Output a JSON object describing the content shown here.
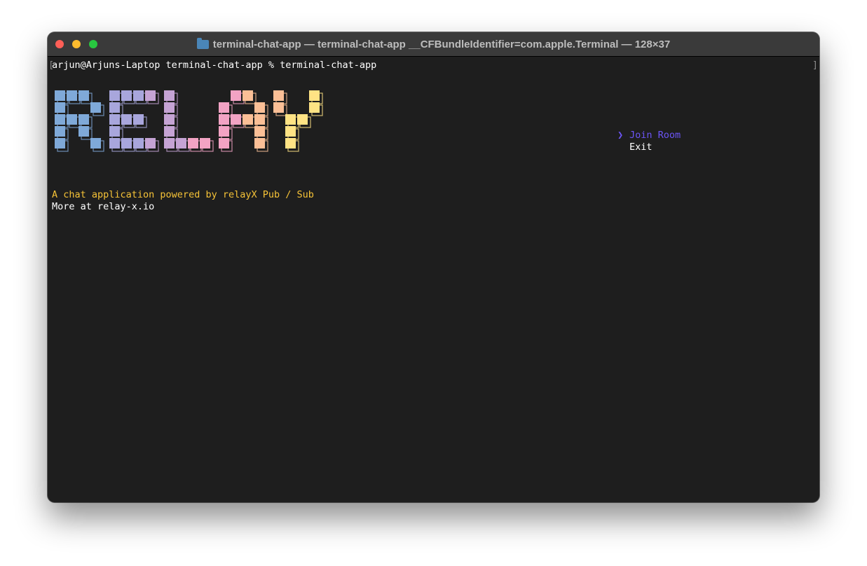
{
  "window": {
    "title": "terminal-chat-app — terminal-chat-app __CFBundleIdentifier=com.apple.Terminal — 128×37",
    "title_icon": "folder-icon",
    "controls": [
      "close",
      "minimize",
      "zoom"
    ]
  },
  "terminal": {
    "prompt": "arjun@Arjuns-Laptop terminal-chat-app % terminal-chat-app",
    "logo_text": "RELAY",
    "logo_gradient": [
      "#7fa9d8",
      "#a8a6dc",
      "#c5a3d4",
      "#f2a3c4",
      "#fbbf96",
      "#ffe384"
    ],
    "tagline": "A chat application powered by relayX Pub / Sub",
    "more_info": "More at relay-x.io",
    "colors": {
      "background": "#1e1e1e",
      "text": "#ffffff",
      "tagline": "#f6c337",
      "selected": "#6c55f7"
    }
  },
  "menu": {
    "pointer": "❯",
    "items": [
      {
        "label": "Join Room",
        "selected": true
      },
      {
        "label": "Exit",
        "selected": false
      }
    ]
  }
}
